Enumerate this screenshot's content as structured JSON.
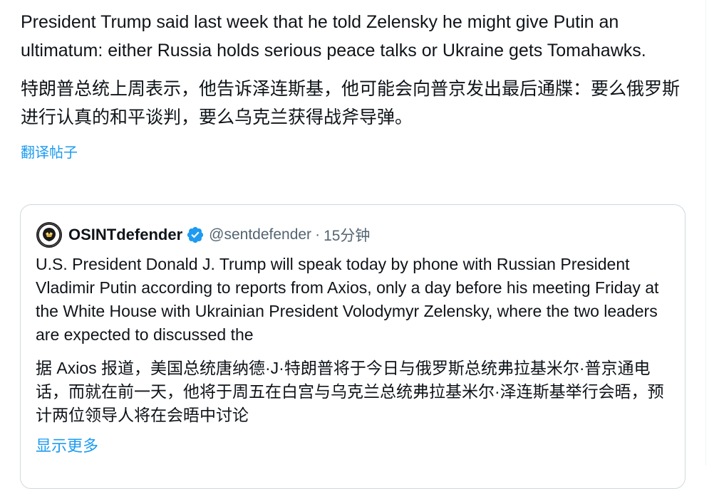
{
  "tweet": {
    "text_en": "President Trump said last week that he told Zelensky he might give Putin an ultimatum: either Russia holds serious peace talks or Ukraine gets Tomahawks.",
    "text_zh": "特朗普总统上周表示，他告诉泽连斯基，他可能会向普京发出最后通牒：要么俄罗斯进行认真的和平谈判，要么乌克兰获得战斧导弹。",
    "translate_label": "翻译帖子"
  },
  "quote": {
    "author_name": "OSINTdefender",
    "handle": "@sentdefender",
    "separator": "·",
    "time": "15分钟",
    "verified_icon": "verified-badge-icon",
    "text_en": "U.S. President Donald J. Trump will speak today by phone with Russian President Vladimir Putin according to reports from Axios, only a day before his meeting Friday at the White House with Ukrainian President Volodymyr Zelensky, where the two leaders are expected to discussed the",
    "text_zh": "据 Axios 报道，美国总统唐纳德·J·特朗普将于今日与俄罗斯总统弗拉基米尔·普京通电话，而就在前一天，他将于周五在白宫与乌克兰总统弗拉基米尔·泽连斯基举行会晤，预计两位领导人将在会晤中讨论",
    "show_more_label": "显示更多"
  },
  "colors": {
    "link": "#1d9bf0",
    "text_primary": "#0f1419",
    "text_secondary": "#536471",
    "border": "#cfd9de"
  }
}
